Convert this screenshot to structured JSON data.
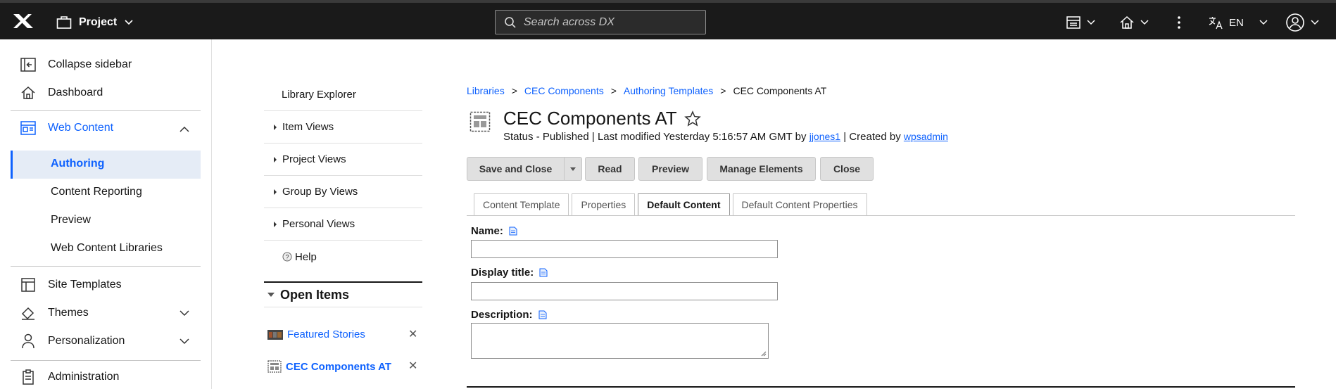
{
  "topbar": {
    "project_label": "Project",
    "search_placeholder": "Search across DX",
    "language": "EN"
  },
  "sidebar": {
    "collapse": "Collapse sidebar",
    "dashboard": "Dashboard",
    "web_content": "Web Content",
    "authoring": "Authoring",
    "content_reporting": "Content Reporting",
    "preview": "Preview",
    "web_content_libraries": "Web Content Libraries",
    "site_templates": "Site Templates",
    "themes": "Themes",
    "personalization": "Personalization",
    "administration": "Administration"
  },
  "library": {
    "explorer": "Library Explorer",
    "item_views": "Item Views",
    "project_views": "Project Views",
    "group_by_views": "Group By Views",
    "personal_views": "Personal Views",
    "help": "Help",
    "open_items": "Open Items",
    "open_list": [
      "Featured Stories",
      "CEC Components AT"
    ]
  },
  "breadcrumb": [
    "Libraries",
    "CEC Components",
    "Authoring Templates",
    "CEC Components AT"
  ],
  "item": {
    "title": "CEC Components AT",
    "status_prefix": "Status - Published | Last modified Yesterday 5:16:57 AM GMT by",
    "modified_by": "jjones1",
    "created_prefix": "| Created by",
    "created_by": "wpsadmin"
  },
  "buttons": {
    "save_close": "Save and Close",
    "read": "Read",
    "preview": "Preview",
    "manage_elements": "Manage Elements",
    "close": "Close"
  },
  "tabs": [
    "Content Template",
    "Properties",
    "Default Content",
    "Default Content Properties"
  ],
  "form": {
    "name_label": "Name:",
    "display_title_label": "Display title:",
    "description_label": "Description:"
  },
  "colors": {
    "accent": "#0f62fe",
    "topbar": "#1a1a1a"
  }
}
